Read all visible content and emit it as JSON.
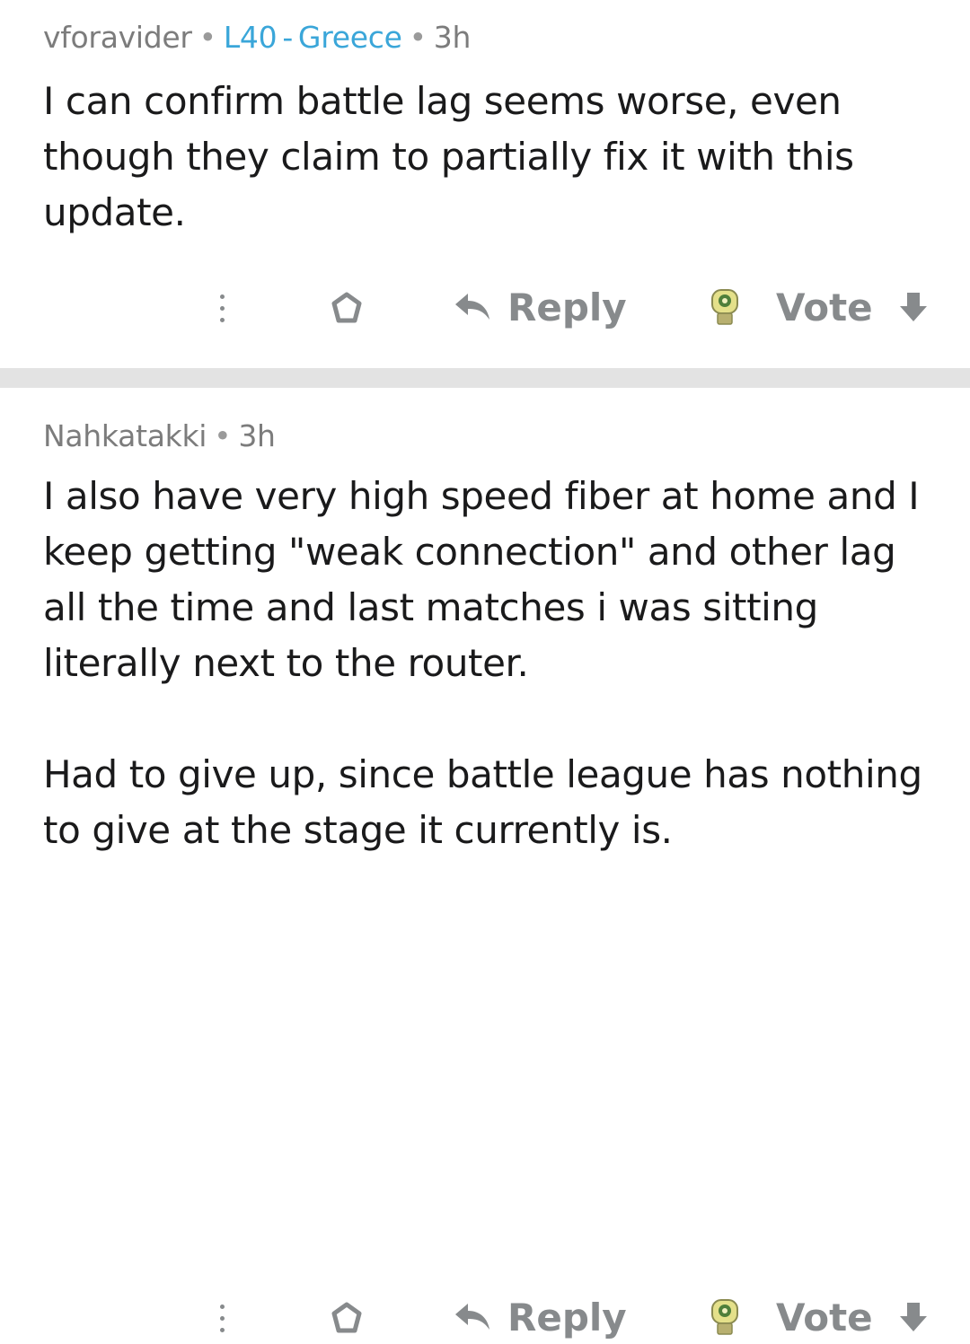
{
  "comments": [
    {
      "author": "vforavider",
      "flair_level": "L40",
      "flair_country": "Greece",
      "time": "3h",
      "paragraphs": [
        "I can confirm battle lag seems worse, even though they claim to partially fix it with this update."
      ],
      "actions": {
        "more_icon": "more-vertical-icon",
        "award_icon": "award-icon",
        "reply_label": "Reply",
        "reply_icon": "reply-arrow-icon",
        "vote_label": "Vote",
        "upvote_icon": "custom-upvote-icon",
        "downvote_icon": "downvote-arrow-icon"
      }
    },
    {
      "author": "Nahkatakki",
      "time": "3h",
      "paragraphs": [
        "I also have very high speed fiber at home and I keep getting \"weak connection\" and other lag all the time and last matches i was sitting literally next to the router.",
        "Had to give up, since battle league has nothing to give at the stage it currently is."
      ],
      "actions": {
        "more_icon": "more-vertical-icon",
        "award_icon": "award-icon",
        "reply_label": "Reply",
        "reply_icon": "reply-arrow-icon",
        "vote_label": "Vote",
        "upvote_icon": "custom-upvote-icon",
        "downvote_icon": "downvote-arrow-icon"
      }
    }
  ],
  "colors": {
    "flair": "#3aa6d9",
    "meta": "#7c7c7c",
    "action": "#878a8c",
    "divider": "#e3e3e3",
    "upvote_icon": "#b8a830"
  }
}
